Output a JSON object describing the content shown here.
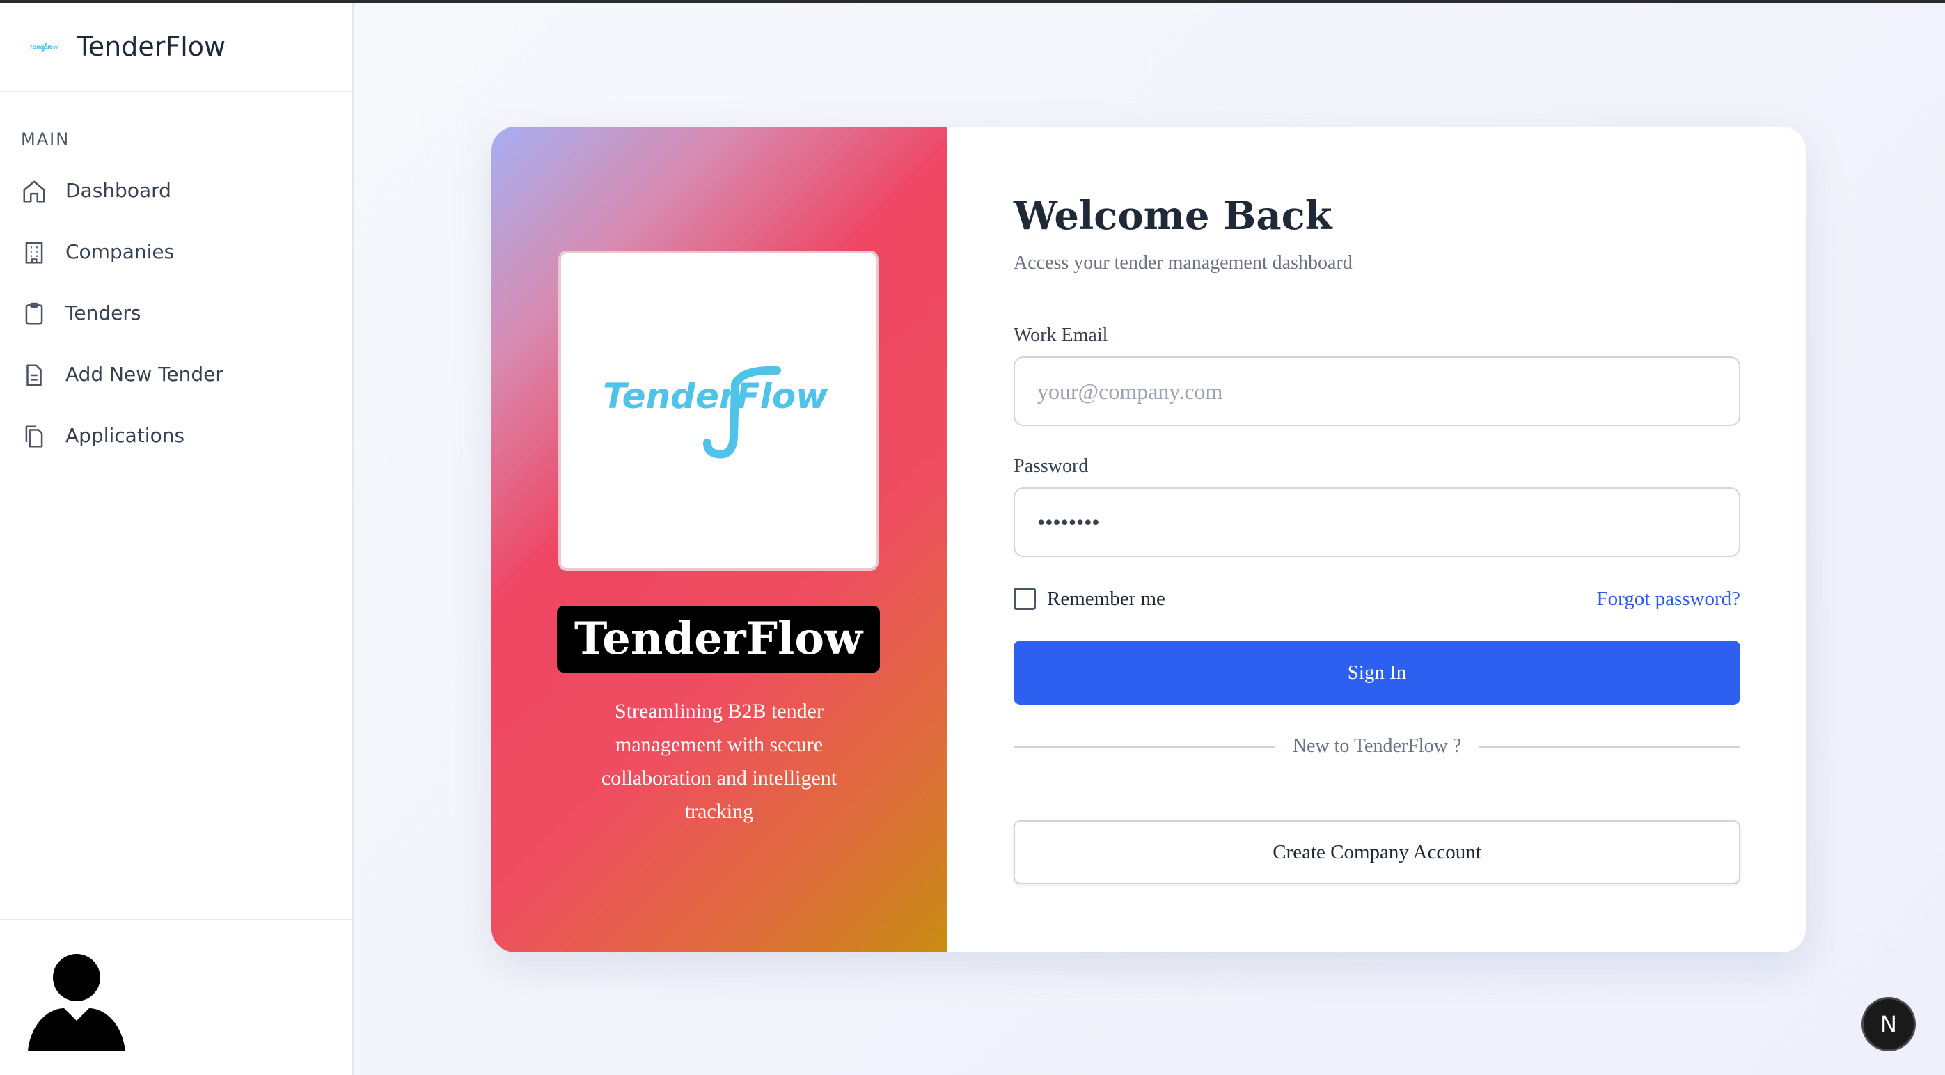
{
  "sidebar": {
    "brand_name": "TenderFlow",
    "section_label": "MAIN",
    "items": [
      {
        "label": "Dashboard",
        "icon": "home-icon"
      },
      {
        "label": "Companies",
        "icon": "building-icon"
      },
      {
        "label": "Tenders",
        "icon": "clipboard-icon"
      },
      {
        "label": "Add New Tender",
        "icon": "document-icon"
      },
      {
        "label": "Applications",
        "icon": "copy-icon"
      }
    ],
    "avatar_icon": "user-avatar-icon"
  },
  "hero": {
    "logo_text": "TenderFlow",
    "title": "TenderFlow",
    "subtitle": "Streamlining B2B tender management with secure collaboration and intelligent tracking"
  },
  "login": {
    "title": "Welcome Back",
    "subtitle": "Access your tender management dashboard",
    "email_label": "Work Email",
    "email_placeholder": "your@company.com",
    "password_label": "Password",
    "password_value": "••••••••",
    "remember_label": "Remember me",
    "forgot_label": "Forgot password?",
    "signin_label": "Sign In",
    "divider_text": "New to TenderFlow ?",
    "create_label": "Create Company Account"
  },
  "badge": {
    "letter": "N"
  },
  "colors": {
    "primary": "#2d5ff0",
    "link": "#2d5be3",
    "logo": "#4fc3e8",
    "hero_gradient": [
      "#a6aef2",
      "#ef4663",
      "#c98c12"
    ]
  }
}
